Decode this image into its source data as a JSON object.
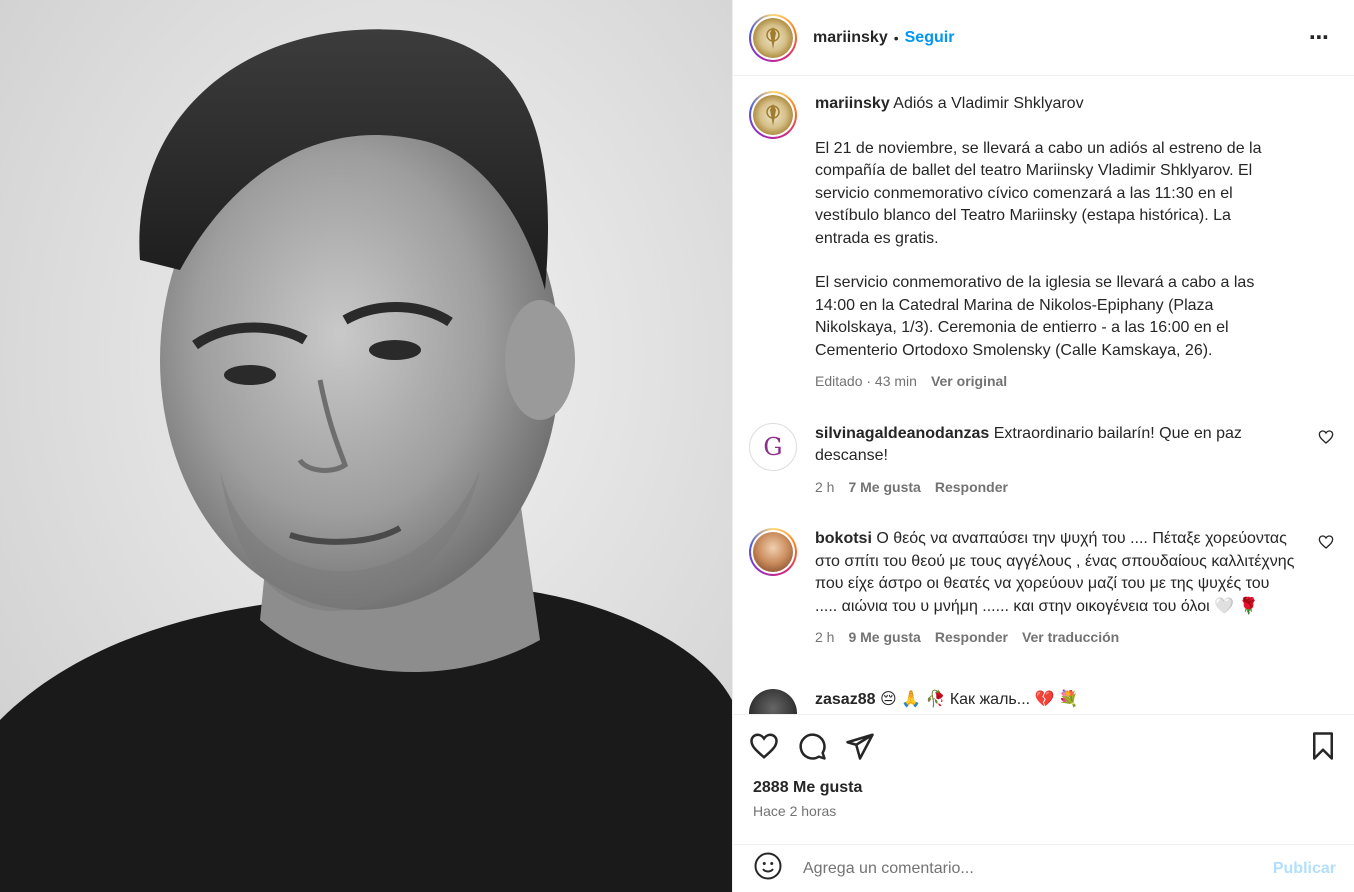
{
  "header": {
    "username": "mariinsky",
    "separator": "•",
    "follow_label": "Seguir",
    "more_label": "⋯"
  },
  "caption": {
    "username": "mariinsky",
    "title": "Adiós a Vladimir Shklyarov",
    "paragraph1": "El 21 de noviembre, se llevará a cabo un adiós al estreno de la compañía de ballet del teatro Mariinsky Vladimir Shklyarov. El servicio conmemorativo cívico comenzará a las 11:30 en el vestíbulo blanco del Teatro Mariinsky (estapa histórica). La entrada es gratis.",
    "paragraph2": "El servicio conmemorativo de la iglesia se llevará a cabo a las 14:00 en la Catedral Marina de Nikolos-Epiphany (Plaza Nikolskaya, 1/3). Ceremonia de entierro - a las 16:00 en el Cementerio Ortodoxo Smolensky (Calle Kamskaya, 26).",
    "edited": "Editado · 43 min",
    "see_original": "Ver original"
  },
  "comments": [
    {
      "username": "silvinagaldeanodanzas",
      "text": "Extraordinario bailarín! Que en paz descanse!",
      "time": "2 h",
      "likes": "7 Me gusta",
      "reply": "Responder",
      "avatar_color": "#8b2d8b"
    },
    {
      "username": "bokotsi",
      "text": "Ο θεός να αναπαύσει την ψυχή του .... Πέταξε χορεύοντας στο σπίτι του θεού με τους αγγέλους , ένας σπουδαίους καλλιτέχνης που είχε άστρο οι θεατές να χορεύουν μαζί του με της ψυχές του ..... αιώνια του υ μνήμη ...... και στην οικογένεια του όλοι 🤍 🌹",
      "time": "2 h",
      "likes": "9 Me gusta",
      "reply": "Responder",
      "translate": "Ver traducción",
      "avatar_color": "#c98a5a"
    },
    {
      "username": "zasaz88",
      "text": "😔 🙏 🥀 Как жаль... 💔 💐",
      "avatar_color": "#2a2a2a"
    }
  ],
  "actions": {
    "icons": [
      "heart-icon",
      "comment-icon",
      "share-icon",
      "bookmark-icon"
    ],
    "likes": "2888 Me gusta",
    "time_ago": "Hace 2 horas"
  },
  "add_comment": {
    "placeholder": "Agrega un comentario...",
    "publish_label": "Publicar"
  },
  "colors": {
    "accent": "#0095f6",
    "muted": "#737373",
    "publish_disabled": "#b2dffc"
  }
}
